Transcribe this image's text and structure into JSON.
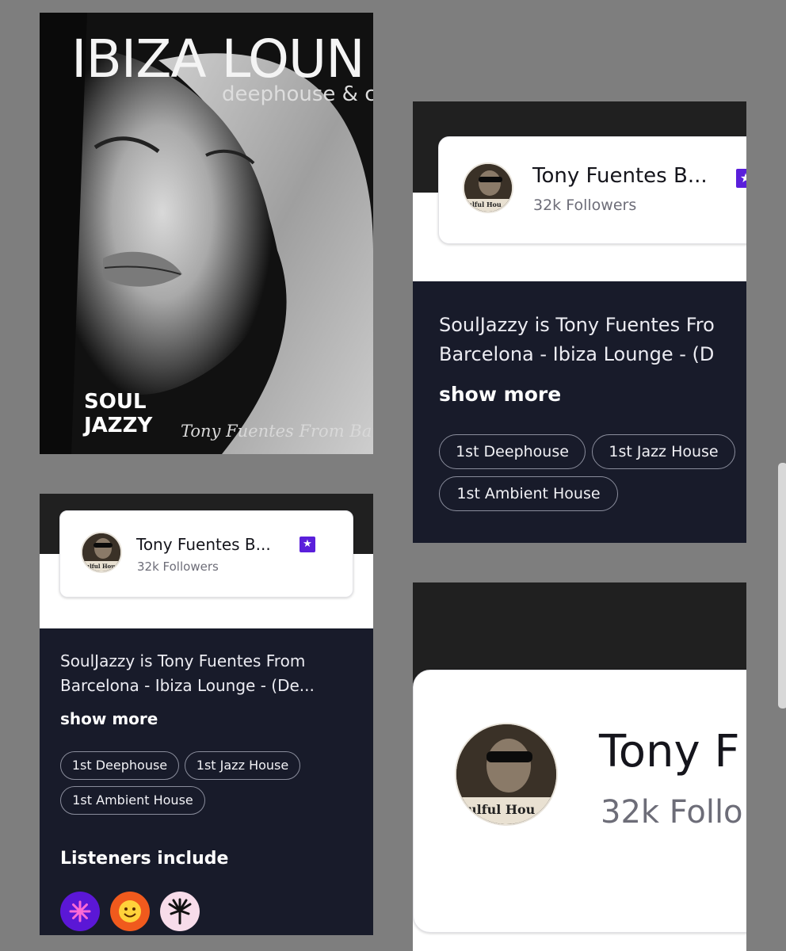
{
  "cover": {
    "title": "IBIZA LOUN",
    "subtitle": "deephouse & c",
    "tag_line1": "SOUL",
    "tag_line2": "JAZZY",
    "artist": "Tony Fuentes From Barc"
  },
  "avatar_text": "ulful Hou",
  "card_right": {
    "name": "Tony Fuentes B...",
    "followers": "32k Followers",
    "bio_line1": "SoulJazzy is Tony Fuentes Fro",
    "bio_line2": "Barcelona - Ibiza Lounge - (D",
    "show_more": "show more",
    "tags": [
      "1st Deephouse",
      "1st Jazz House",
      "1st Ambient House"
    ]
  },
  "card_left": {
    "name": "Tony Fuentes B...",
    "followers": "32k Followers",
    "bio_line1": "SoulJazzy is Tony Fuentes From",
    "bio_line2": "Barcelona - Ibiza Lounge - (De...",
    "show_more": "show more",
    "tags": [
      "1st Deephouse",
      "1st Jazz House",
      "1st Ambient House"
    ],
    "listeners_heading": "Listeners include",
    "listeners": [
      {
        "name": "asterisk-listener",
        "bg": "#5b17d6",
        "fg": "#ff6ad5"
      },
      {
        "name": "smiley-listener",
        "bg": "#f05a1d",
        "fg": "#ffd23a"
      },
      {
        "name": "palm-listener",
        "bg": "#f7dcea",
        "fg": "#111111"
      }
    ]
  },
  "card_zoom": {
    "name": "Tony F",
    "followers": "32k Follo"
  },
  "colors": {
    "accent_purple": "#5a1fdb",
    "card_dark": "#181b2a",
    "page_bg": "#7e7e7e"
  }
}
